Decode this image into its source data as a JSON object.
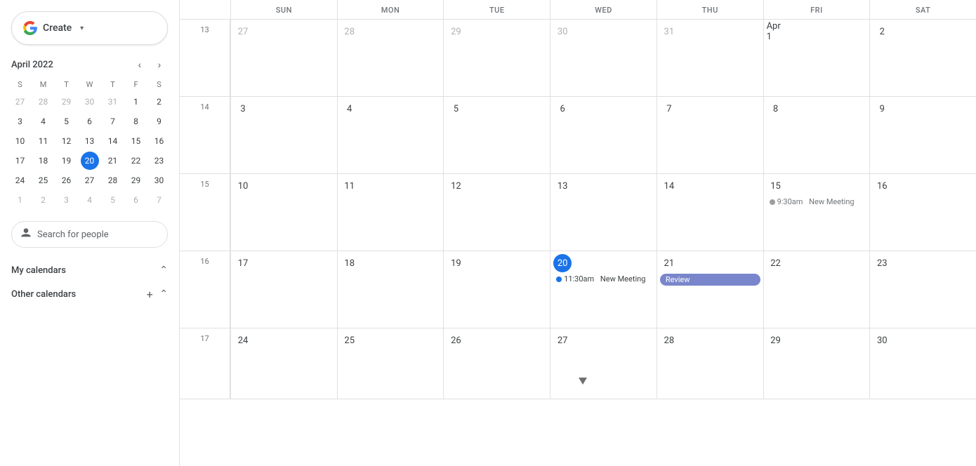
{
  "sidebar": {
    "create_label": "Create",
    "create_arrow": "▾",
    "mini_cal": {
      "title": "April 2022",
      "dow_headers": [
        "S",
        "M",
        "T",
        "W",
        "T",
        "F",
        "S"
      ],
      "weeks": [
        [
          {
            "num": "27",
            "other": true
          },
          {
            "num": "28",
            "other": true
          },
          {
            "num": "29",
            "other": true
          },
          {
            "num": "30",
            "other": true
          },
          {
            "num": "31",
            "other": true
          },
          {
            "num": "1",
            "other": false
          },
          {
            "num": "2",
            "other": false
          }
        ],
        [
          {
            "num": "3",
            "other": false
          },
          {
            "num": "4",
            "other": false
          },
          {
            "num": "5",
            "other": false
          },
          {
            "num": "6",
            "other": false
          },
          {
            "num": "7",
            "other": false
          },
          {
            "num": "8",
            "other": false
          },
          {
            "num": "9",
            "other": false
          }
        ],
        [
          {
            "num": "10",
            "other": false
          },
          {
            "num": "11",
            "other": false
          },
          {
            "num": "12",
            "other": false
          },
          {
            "num": "13",
            "other": false
          },
          {
            "num": "14",
            "other": false
          },
          {
            "num": "15",
            "other": false
          },
          {
            "num": "16",
            "other": false
          }
        ],
        [
          {
            "num": "17",
            "other": false
          },
          {
            "num": "18",
            "other": false
          },
          {
            "num": "19",
            "other": false
          },
          {
            "num": "20",
            "other": false,
            "today": true
          },
          {
            "num": "21",
            "other": false
          },
          {
            "num": "22",
            "other": false
          },
          {
            "num": "23",
            "other": false
          }
        ],
        [
          {
            "num": "24",
            "other": false
          },
          {
            "num": "25",
            "other": false
          },
          {
            "num": "26",
            "other": false
          },
          {
            "num": "27",
            "other": false
          },
          {
            "num": "28",
            "other": false
          },
          {
            "num": "29",
            "other": false
          },
          {
            "num": "30",
            "other": false
          }
        ],
        [
          {
            "num": "1",
            "other": true
          },
          {
            "num": "2",
            "other": true
          },
          {
            "num": "3",
            "other": true
          },
          {
            "num": "4",
            "other": true
          },
          {
            "num": "5",
            "other": true
          },
          {
            "num": "6",
            "other": true
          },
          {
            "num": "7",
            "other": true
          }
        ]
      ]
    },
    "search_people_placeholder": "Search for people",
    "my_calendars_label": "My calendars",
    "other_calendars_label": "Other calendars"
  },
  "calendar": {
    "dow_headers": [
      "SUN",
      "MON",
      "TUE",
      "WED",
      "THU",
      "FRI",
      "SAT"
    ],
    "weeks": [
      {
        "week_num": "13",
        "days": [
          {
            "num": "27",
            "today": false,
            "other": true
          },
          {
            "num": "28",
            "today": false,
            "other": true
          },
          {
            "num": "29",
            "today": false,
            "other": true
          },
          {
            "num": "30",
            "today": false,
            "other": true
          },
          {
            "num": "31",
            "today": false,
            "other": true
          },
          {
            "num": "Apr 1",
            "today": false,
            "other": false,
            "apr1": true
          },
          {
            "num": "2",
            "today": false,
            "other": false
          }
        ],
        "events": []
      },
      {
        "week_num": "14",
        "days": [
          {
            "num": "3",
            "today": false
          },
          {
            "num": "4",
            "today": false
          },
          {
            "num": "5",
            "today": false
          },
          {
            "num": "6",
            "today": false
          },
          {
            "num": "7",
            "today": false
          },
          {
            "num": "8",
            "today": false
          },
          {
            "num": "9",
            "today": false
          }
        ],
        "events": []
      },
      {
        "week_num": "15",
        "days": [
          {
            "num": "10",
            "today": false
          },
          {
            "num": "11",
            "today": false
          },
          {
            "num": "12",
            "today": false
          },
          {
            "num": "13",
            "today": false
          },
          {
            "num": "14",
            "today": false
          },
          {
            "num": "15",
            "today": false
          },
          {
            "num": "16",
            "today": false
          }
        ],
        "events": [
          {
            "day_index": 5,
            "type": "faded",
            "text": "9:30am New Meeting"
          }
        ]
      },
      {
        "week_num": "16",
        "days": [
          {
            "num": "17",
            "today": false
          },
          {
            "num": "18",
            "today": false
          },
          {
            "num": "19",
            "today": false
          },
          {
            "num": "20",
            "today": true
          },
          {
            "num": "21",
            "today": false
          },
          {
            "num": "22",
            "today": false
          },
          {
            "num": "23",
            "today": false
          }
        ],
        "events": [
          {
            "day_index": 3,
            "type": "dot",
            "text": "11:30am New Meeting"
          },
          {
            "day_index": 4,
            "type": "purple",
            "text": "Review"
          }
        ]
      },
      {
        "week_num": "17",
        "days": [
          {
            "num": "24",
            "today": false
          },
          {
            "num": "25",
            "today": false
          },
          {
            "num": "26",
            "today": false
          },
          {
            "num": "27",
            "today": false
          },
          {
            "num": "28",
            "today": false
          },
          {
            "num": "29",
            "today": false
          },
          {
            "num": "30",
            "today": false
          }
        ],
        "events": []
      }
    ]
  },
  "colors": {
    "today_bg": "#1a73e8",
    "today_text": "#fff",
    "purple_event": "#7986cb",
    "blue_dot": "#1a73e8"
  }
}
